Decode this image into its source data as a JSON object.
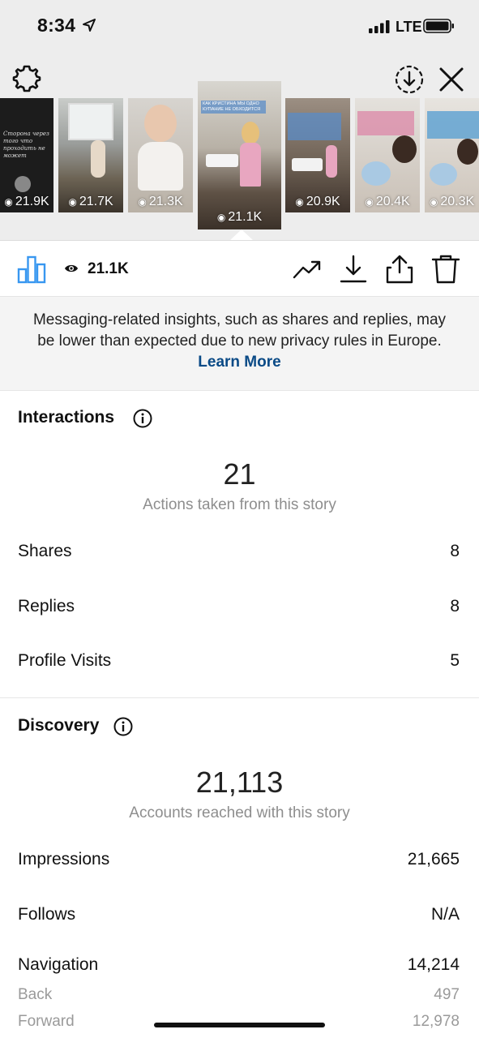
{
  "status_bar": {
    "time": "8:34",
    "network": "LTE"
  },
  "story_strip": {
    "thumbnails": [
      {
        "views": "21.9K",
        "caption": "Сторона через того что проходить не может"
      },
      {
        "views": "21.7K",
        "caption": ""
      },
      {
        "views": "21.3K",
        "caption": ""
      },
      {
        "views": "21.1K",
        "caption": "КАК КРИСТИНА МЫ ОДНО КУПАНИЕ НЕ ОБХОДИТСЯ",
        "selected": true
      },
      {
        "views": "20.9K",
        "caption": ""
      },
      {
        "views": "20.4K",
        "caption": ""
      },
      {
        "views": "20.3K",
        "caption": ""
      }
    ]
  },
  "toolbar": {
    "view_count": "21.1K"
  },
  "notice": {
    "text": "Messaging-related insights, such as shares and replies, may be lower than expected due to new privacy rules in Europe.",
    "link": "Learn More"
  },
  "interactions": {
    "title": "Interactions",
    "total": "21",
    "total_label": "Actions taken from this story",
    "rows": [
      {
        "label": "Shares",
        "value": "8"
      },
      {
        "label": "Replies",
        "value": "8"
      },
      {
        "label": "Profile Visits",
        "value": "5"
      }
    ]
  },
  "discovery": {
    "title": "Discovery",
    "total": "21,113",
    "total_label": "Accounts reached with this story",
    "rows": [
      {
        "label": "Impressions",
        "value": "21,665"
      },
      {
        "label": "Follows",
        "value": "N/A"
      },
      {
        "label": "Navigation",
        "value": "14,214"
      }
    ],
    "navigation_sub": [
      {
        "label": "Back",
        "value": "497"
      },
      {
        "label": "Forward",
        "value": "12,978"
      }
    ]
  },
  "colors": {
    "accent": "#3897f0",
    "link": "#0a4a86",
    "muted": "#8e8e8e"
  }
}
